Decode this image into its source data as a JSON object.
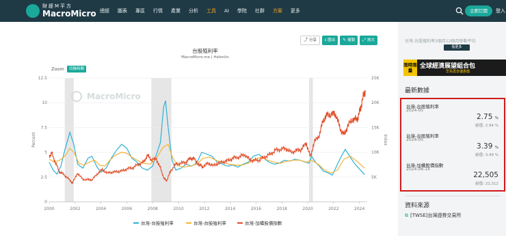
{
  "brand": {
    "sub": "財經M平方",
    "name": "MacroMicro"
  },
  "nav": {
    "items": [
      {
        "label": "總經",
        "active": false
      },
      {
        "label": "圖表",
        "active": false
      },
      {
        "label": "專區",
        "active": false
      },
      {
        "label": "行情",
        "active": false
      },
      {
        "label": "產業",
        "active": false
      },
      {
        "label": "分析",
        "active": false
      },
      {
        "label": "工具",
        "active": true
      },
      {
        "label": "AI",
        "active": false
      },
      {
        "label": "學院",
        "active": false
      },
      {
        "label": "社群",
        "active": false
      },
      {
        "label": "方案",
        "active": true
      },
      {
        "label": "更多",
        "active": false
      }
    ],
    "subscribe_label": "立即訂閱",
    "login_label": "登入"
  },
  "toolbar": {
    "share": "分享",
    "export": "匯出",
    "copy": "複製",
    "zoom": "放大"
  },
  "chart_header": {
    "title": "台股殖利率",
    "subtitle": "MacroMicro.me | Helenlin",
    "zoom_label": "Zoom",
    "zoom_toggle": "切換時間"
  },
  "chart_data": {
    "type": "line",
    "left_axis": {
      "label": "Percent",
      "ticks": [
        "0",
        "2.5",
        "5",
        "7.5",
        "10",
        "12.5"
      ],
      "range": [
        0,
        12.5
      ]
    },
    "right_axis": {
      "label": "Index",
      "ticks": [
        "5K",
        "10K",
        "15K",
        "20K",
        "25K"
      ],
      "range": [
        0,
        25000
      ]
    },
    "x_ticks": [
      "2000",
      "2002",
      "2004",
      "2006",
      "2008",
      "2010",
      "2012",
      "2014",
      "2016",
      "2018",
      "2020",
      "2022",
      "2024"
    ],
    "x_range": [
      2000,
      2024.6
    ],
    "watermark": "MacroMicro",
    "recessions": [
      [
        2001.2,
        2001.9
      ],
      [
        2007.9,
        2009.45
      ],
      [
        2020.1,
        2020.4
      ]
    ],
    "series": [
      {
        "name": "台灣-台股殖利率",
        "color": "#2bb0d6",
        "axis": "left",
        "points": [
          [
            2000,
            4.0
          ],
          [
            2000.3,
            3.2
          ],
          [
            2000.6,
            2.8
          ],
          [
            2000.9,
            3.6
          ],
          [
            2001.2,
            5.2
          ],
          [
            2001.6,
            7.0
          ],
          [
            2001.9,
            5.8
          ],
          [
            2002.2,
            3.8
          ],
          [
            2002.6,
            3.4
          ],
          [
            2003.0,
            4.4
          ],
          [
            2003.3,
            4.6
          ],
          [
            2003.7,
            3.5
          ],
          [
            2004.0,
            3.0
          ],
          [
            2004.4,
            3.4
          ],
          [
            2004.8,
            4.4
          ],
          [
            2005.2,
            5.2
          ],
          [
            2005.6,
            5.8
          ],
          [
            2006.0,
            5.4
          ],
          [
            2006.4,
            4.4
          ],
          [
            2006.8,
            4.0
          ],
          [
            2007.2,
            3.4
          ],
          [
            2007.6,
            3.2
          ],
          [
            2008.0,
            3.6
          ],
          [
            2008.3,
            4.8
          ],
          [
            2008.6,
            6.0
          ],
          [
            2008.85,
            9.6
          ],
          [
            2009.0,
            10.2
          ],
          [
            2009.2,
            7.5
          ],
          [
            2009.5,
            4.2
          ],
          [
            2009.8,
            3.2
          ],
          [
            2010.2,
            3.4
          ],
          [
            2010.6,
            3.8
          ],
          [
            2011.0,
            3.6
          ],
          [
            2011.4,
            3.9
          ],
          [
            2011.8,
            5.0
          ],
          [
            2012.2,
            4.8
          ],
          [
            2012.6,
            4.6
          ],
          [
            2013.0,
            4.0
          ],
          [
            2013.4,
            3.8
          ],
          [
            2013.8,
            3.6
          ],
          [
            2014.2,
            3.7
          ],
          [
            2014.6,
            3.5
          ],
          [
            2015.0,
            3.8
          ],
          [
            2015.4,
            4.0
          ],
          [
            2015.8,
            4.6
          ],
          [
            2016.2,
            4.8
          ],
          [
            2016.6,
            4.4
          ],
          [
            2017.0,
            4.0
          ],
          [
            2017.4,
            3.8
          ],
          [
            2017.8,
            3.9
          ],
          [
            2018.2,
            4.2
          ],
          [
            2018.6,
            4.1
          ],
          [
            2019.0,
            4.3
          ],
          [
            2019.4,
            4.2
          ],
          [
            2019.8,
            4.0
          ],
          [
            2020.1,
            3.9
          ],
          [
            2020.3,
            4.6
          ],
          [
            2020.6,
            4.0
          ],
          [
            2020.9,
            3.6
          ],
          [
            2021.2,
            3.1
          ],
          [
            2021.6,
            2.9
          ],
          [
            2021.9,
            2.7
          ],
          [
            2022.2,
            3.5
          ],
          [
            2022.6,
            4.6
          ],
          [
            2022.9,
            5.3
          ],
          [
            2023.2,
            4.7
          ],
          [
            2023.6,
            3.9
          ],
          [
            2024.0,
            3.3
          ],
          [
            2024.4,
            2.75
          ]
        ]
      },
      {
        "name": "台灣-台股殖利率",
        "color": "#f5b335",
        "axis": "left",
        "points": [
          [
            2000,
            4.3
          ],
          [
            2000.4,
            4.0
          ],
          [
            2000.8,
            4.2
          ],
          [
            2001.2,
            4.6
          ],
          [
            2001.6,
            5.4
          ],
          [
            2001.9,
            5.0
          ],
          [
            2002.3,
            3.9
          ],
          [
            2002.7,
            3.7
          ],
          [
            2003.1,
            4.0
          ],
          [
            2003.5,
            4.2
          ],
          [
            2003.9,
            3.7
          ],
          [
            2004.3,
            3.6
          ],
          [
            2004.7,
            4.2
          ],
          [
            2005.1,
            4.7
          ],
          [
            2005.6,
            5.0
          ],
          [
            2006.0,
            4.9
          ],
          [
            2006.4,
            4.5
          ],
          [
            2006.8,
            4.2
          ],
          [
            2007.3,
            3.9
          ],
          [
            2007.8,
            3.8
          ],
          [
            2008.3,
            4.4
          ],
          [
            2008.8,
            5.5
          ],
          [
            2009.2,
            5.8
          ],
          [
            2009.5,
            4.6
          ],
          [
            2009.9,
            3.7
          ],
          [
            2010.4,
            3.5
          ],
          [
            2010.9,
            3.6
          ],
          [
            2011.4,
            3.8
          ],
          [
            2011.9,
            4.4
          ],
          [
            2012.4,
            4.5
          ],
          [
            2012.9,
            4.2
          ],
          [
            2013.4,
            4.0
          ],
          [
            2013.9,
            3.8
          ],
          [
            2014.4,
            3.7
          ],
          [
            2014.9,
            3.7
          ],
          [
            2015.4,
            3.9
          ],
          [
            2015.9,
            4.3
          ],
          [
            2016.4,
            4.5
          ],
          [
            2016.9,
            4.2
          ],
          [
            2017.4,
            4.0
          ],
          [
            2017.9,
            3.9
          ],
          [
            2018.4,
            4.1
          ],
          [
            2018.9,
            4.2
          ],
          [
            2019.4,
            4.2
          ],
          [
            2019.9,
            4.0
          ],
          [
            2020.3,
            4.2
          ],
          [
            2020.8,
            3.8
          ],
          [
            2021.3,
            3.2
          ],
          [
            2021.8,
            2.9
          ],
          [
            2022.3,
            3.2
          ],
          [
            2022.8,
            4.3
          ],
          [
            2023.3,
            4.6
          ],
          [
            2023.8,
            4.1
          ],
          [
            2024.4,
            3.39
          ]
        ]
      },
      {
        "name": "台灣-加權股價指數",
        "color": "#e04a25",
        "axis": "right",
        "points": [
          [
            2000,
            9200
          ],
          [
            2000.2,
            9800
          ],
          [
            2000.5,
            7800
          ],
          [
            2000.8,
            6000
          ],
          [
            2001.1,
            5600
          ],
          [
            2001.5,
            4600
          ],
          [
            2001.8,
            3800
          ],
          [
            2002.2,
            5800
          ],
          [
            2002.6,
            4500
          ],
          [
            2003.0,
            4500
          ],
          [
            2003.3,
            4400
          ],
          [
            2003.7,
            5600
          ],
          [
            2004.1,
            6500
          ],
          [
            2004.5,
            5800
          ],
          [
            2004.9,
            6000
          ],
          [
            2005.3,
            6100
          ],
          [
            2005.7,
            6300
          ],
          [
            2006.1,
            6700
          ],
          [
            2006.5,
            6900
          ],
          [
            2006.9,
            7600
          ],
          [
            2007.3,
            8000
          ],
          [
            2007.6,
            9400
          ],
          [
            2007.9,
            8500
          ],
          [
            2008.3,
            8600
          ],
          [
            2008.6,
            6800
          ],
          [
            2008.9,
            4600
          ],
          [
            2009.1,
            4300
          ],
          [
            2009.4,
            6300
          ],
          [
            2009.8,
            7600
          ],
          [
            2010.2,
            7800
          ],
          [
            2010.6,
            8000
          ],
          [
            2010.9,
            8800
          ],
          [
            2011.2,
            8700
          ],
          [
            2011.6,
            7400
          ],
          [
            2011.9,
            7100
          ],
          [
            2012.3,
            7800
          ],
          [
            2012.7,
            7300
          ],
          [
            2013.1,
            7800
          ],
          [
            2013.5,
            8100
          ],
          [
            2013.9,
            8400
          ],
          [
            2014.3,
            8900
          ],
          [
            2014.7,
            9000
          ],
          [
            2015.1,
            9600
          ],
          [
            2015.5,
            8500
          ],
          [
            2015.9,
            8300
          ],
          [
            2016.3,
            8500
          ],
          [
            2016.7,
            9100
          ],
          [
            2017.1,
            9600
          ],
          [
            2017.5,
            10400
          ],
          [
            2017.9,
            10600
          ],
          [
            2018.3,
            10800
          ],
          [
            2018.7,
            10000
          ],
          [
            2019.1,
            10300
          ],
          [
            2019.5,
            10600
          ],
          [
            2019.9,
            11800
          ],
          [
            2020.2,
            9000
          ],
          [
            2020.5,
            12000
          ],
          [
            2020.9,
            13500
          ],
          [
            2021.2,
            16500
          ],
          [
            2021.5,
            17500
          ],
          [
            2021.9,
            17800
          ],
          [
            2022.2,
            17500
          ],
          [
            2022.5,
            14800
          ],
          [
            2022.8,
            13500
          ],
          [
            2023.1,
            15300
          ],
          [
            2023.5,
            16800
          ],
          [
            2023.8,
            16500
          ],
          [
            2024.0,
            18000
          ],
          [
            2024.2,
            20200
          ],
          [
            2024.45,
            22505
          ]
        ]
      }
    ],
    "legend": [
      "台灣-台股殖利率",
      "台灣-台股殖利率",
      "台灣-加權股價指數"
    ]
  },
  "sidebar": {
    "crumb": "台灣-台股殖利率3個月12個月移動平均",
    "more_label": "看更多",
    "banner": {
      "tag": "限時限量",
      "main": "全球經濟展望組合包",
      "sub": "早鳥再享優惠價"
    },
    "latest_title": "最新數據",
    "latest_items": [
      {
        "name": "台灣-台股殖利率",
        "date": "2024-05",
        "value": "2.75",
        "unit": "%",
        "prev": "前值: 2.94 %"
      },
      {
        "name": "台灣-台股殖利率",
        "date": "2024-05",
        "value": "3.39",
        "unit": "%",
        "prev": "前值: 3.49 %"
      },
      {
        "name": "台灣-加權股價指數",
        "date": "2024-06-14",
        "value": "22,505",
        "unit": "",
        "prev": "前值: 22,312"
      }
    ],
    "source_title": "資料來源",
    "source_link": "[TWSE]台灣證券交易所"
  }
}
